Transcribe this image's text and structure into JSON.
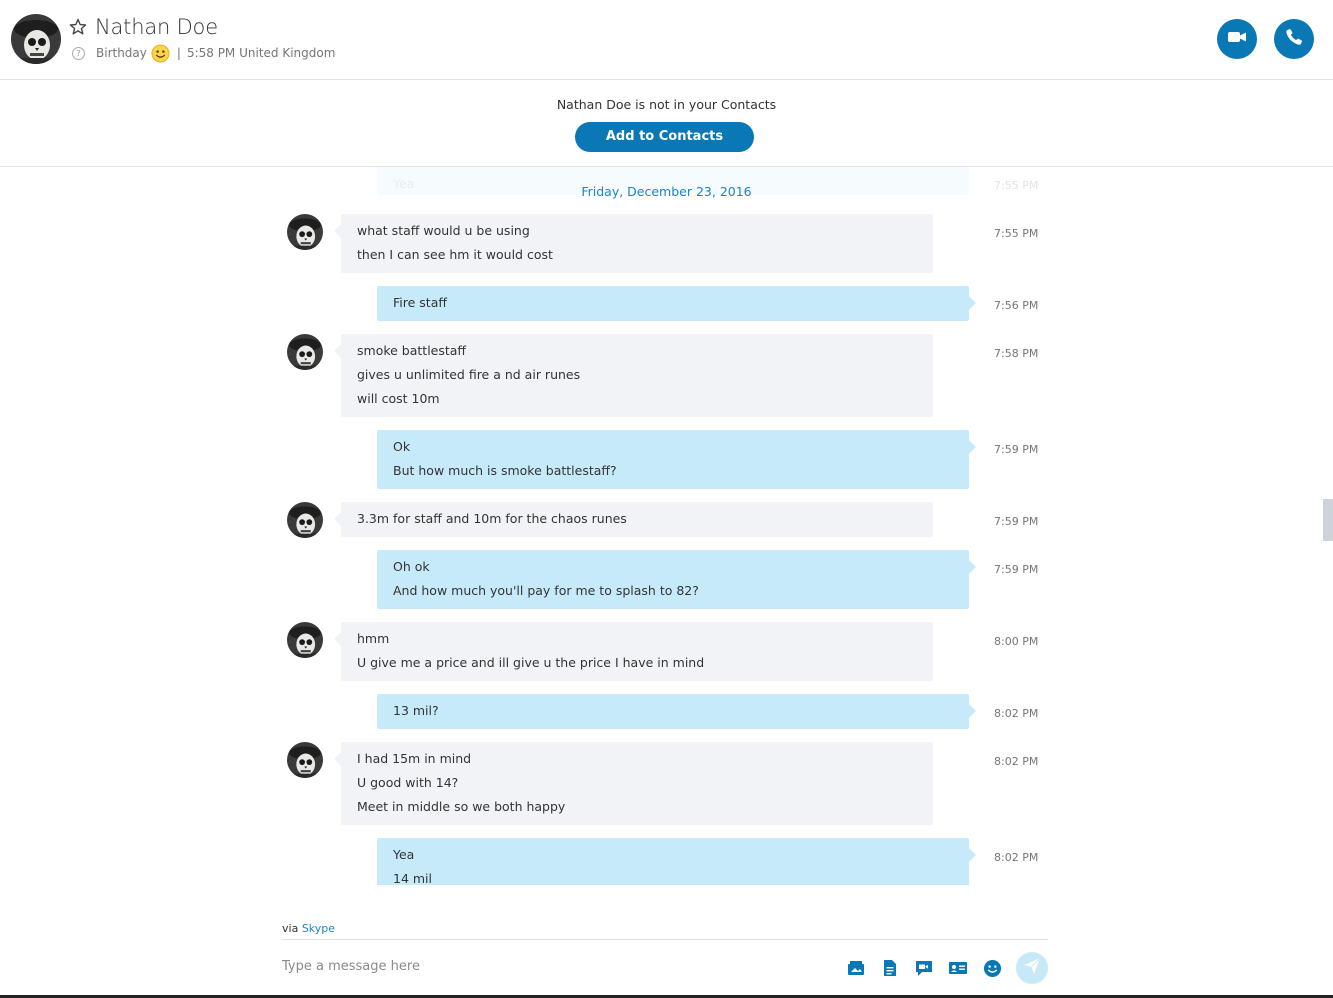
{
  "header": {
    "contact_name": "Nathan Doe",
    "status_label": "Birthday",
    "local_time": "5:58 PM United Kingdom",
    "separator": "|",
    "help_glyph": "?",
    "video_call_icon": "video-camera-icon",
    "audio_call_icon": "phone-icon",
    "accent_color": "#0a78b4"
  },
  "banner": {
    "message": "Nathan Doe is not in your Contacts",
    "add_button": "Add to Contacts"
  },
  "chat": {
    "ghost_message": {
      "text": "Yea",
      "time": "7:55 PM"
    },
    "date_divider": "Friday, December 23, 2016",
    "messages": [
      {
        "from": "them",
        "time": "7:55 PM",
        "lines": [
          "what staff would u be using",
          "then I can see hm it would cost"
        ]
      },
      {
        "from": "me",
        "time": "7:56 PM",
        "lines": [
          "Fire staff"
        ]
      },
      {
        "from": "them",
        "time": "7:58 PM",
        "lines": [
          "smoke battlestaff",
          "gives u unlimited fire a nd air runes",
          "will cost 10m"
        ]
      },
      {
        "from": "me",
        "time": "7:59 PM",
        "lines": [
          "Ok",
          "But how much is smoke battlestaff?"
        ]
      },
      {
        "from": "them",
        "time": "7:59 PM",
        "lines": [
          "3.3m for staff and 10m for the chaos runes"
        ]
      },
      {
        "from": "me",
        "time": "7:59 PM",
        "lines": [
          "Oh ok",
          "And how much you'll pay for me to splash to 82?"
        ]
      },
      {
        "from": "them",
        "time": "8:00 PM",
        "lines": [
          "hmm",
          "U give me a price and ill give u the price I have in mind"
        ]
      },
      {
        "from": "me",
        "time": "8:02 PM",
        "lines": [
          "13 mil?"
        ]
      },
      {
        "from": "them",
        "time": "8:02 PM",
        "lines": [
          "I had 15m in mind",
          "U good with 14?",
          "Meet in middle so we both happy"
        ]
      },
      {
        "from": "me",
        "time": "8:02 PM",
        "lines": [
          "Yea",
          "14 mil"
        ]
      }
    ]
  },
  "compose": {
    "via_prefix": "via",
    "via_link": "Skype",
    "placeholder": "Type a message here",
    "tools": [
      "media-gallery-icon",
      "file-icon",
      "video-message-icon",
      "contact-card-icon",
      "emoticon-icon"
    ],
    "send_icon": "send-icon"
  }
}
